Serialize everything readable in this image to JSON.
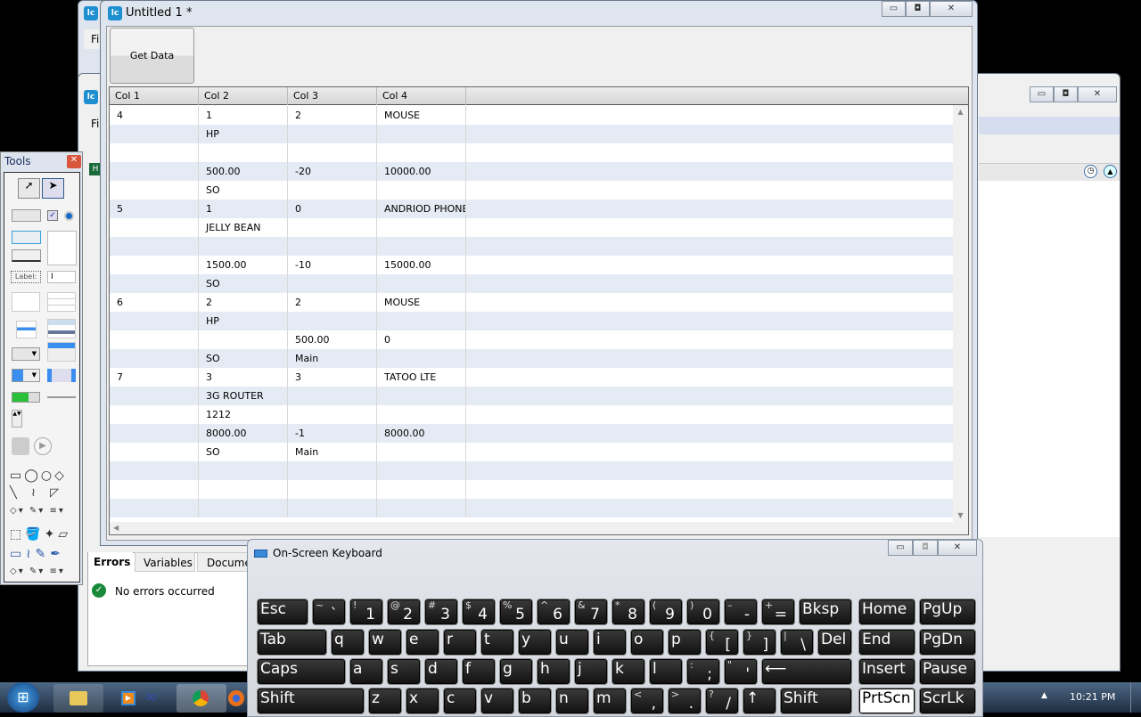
{
  "back_window": {
    "menu_initial": "Fi",
    "status_letter": "H"
  },
  "main_window": {
    "title": "Untitled 1 *",
    "get_data_label": "Get Data",
    "columns": [
      "Col 1",
      "Col 2",
      "Col 3",
      "Col 4"
    ],
    "rows": [
      [
        "4",
        "1",
        "2",
        "MOUSE"
      ],
      [
        "",
        "HP",
        "",
        ""
      ],
      [
        "",
        "",
        "",
        ""
      ],
      [
        "",
        "500.00",
        "-20",
        "10000.00"
      ],
      [
        "",
        "SO",
        "",
        ""
      ],
      [
        "5",
        "1",
        "0",
        "ANDRIOD PHONE"
      ],
      [
        "",
        "JELLY BEAN",
        "",
        ""
      ],
      [
        "",
        "",
        "",
        ""
      ],
      [
        "",
        "1500.00",
        "-10",
        "15000.00"
      ],
      [
        "",
        "SO",
        "",
        ""
      ],
      [
        "6",
        "2",
        "2",
        "MOUSE"
      ],
      [
        "",
        "HP",
        "",
        ""
      ],
      [
        "",
        "",
        "500.00",
        "0"
      ],
      [
        "",
        "SO",
        "Main",
        ""
      ],
      [
        "7",
        "3",
        "3",
        "TATOO LTE"
      ],
      [
        "",
        "3G ROUTER",
        "",
        ""
      ],
      [
        "",
        "1212",
        "",
        ""
      ],
      [
        "",
        "8000.00",
        "-1",
        "8000.00"
      ],
      [
        "",
        "SO",
        "Main",
        ""
      ],
      [
        "",
        "",
        "",
        ""
      ],
      [
        "",
        "",
        "",
        ""
      ],
      [
        "",
        "",
        "",
        ""
      ]
    ]
  },
  "tools": {
    "title": "Tools",
    "label_tool": "Label:"
  },
  "errors_panel": {
    "tabs": [
      "Errors",
      "Variables",
      "Documen"
    ],
    "message": "No errors occurred"
  },
  "keyboard": {
    "title": "On-Screen Keyboard",
    "rows": [
      [
        {
          "m": "Esc"
        },
        {
          "m": "` ",
          "s": "~"
        },
        {
          "m": "1",
          "s": "!"
        },
        {
          "m": "2",
          "s": "@"
        },
        {
          "m": "3",
          "s": "#"
        },
        {
          "m": "4",
          "s": "$"
        },
        {
          "m": "5",
          "s": "%"
        },
        {
          "m": "6",
          "s": "^"
        },
        {
          "m": "7",
          "s": "&"
        },
        {
          "m": "8",
          "s": "*"
        },
        {
          "m": "9",
          "s": "("
        },
        {
          "m": "0",
          "s": ")"
        },
        {
          "m": "-",
          "s": "–"
        },
        {
          "m": "=",
          "s": "+"
        },
        {
          "m": "Bksp"
        },
        {
          "m": "Home"
        },
        {
          "m": "PgUp"
        }
      ],
      [
        {
          "m": "Tab"
        },
        {
          "m": "q"
        },
        {
          "m": "w"
        },
        {
          "m": "e"
        },
        {
          "m": "r"
        },
        {
          "m": "t"
        },
        {
          "m": "y"
        },
        {
          "m": "u"
        },
        {
          "m": "i"
        },
        {
          "m": "o"
        },
        {
          "m": "p"
        },
        {
          "m": "[",
          "s": "{"
        },
        {
          "m": "]",
          "s": "}"
        },
        {
          "m": "\\",
          "s": "|"
        },
        {
          "m": "Del"
        },
        {
          "m": "End"
        },
        {
          "m": "PgDn"
        }
      ],
      [
        {
          "m": "Caps"
        },
        {
          "m": "a"
        },
        {
          "m": "s"
        },
        {
          "m": "d"
        },
        {
          "m": "f"
        },
        {
          "m": "g"
        },
        {
          "m": "h"
        },
        {
          "m": "j"
        },
        {
          "m": "k"
        },
        {
          "m": "l"
        },
        {
          "m": ";",
          "s": ":"
        },
        {
          "m": "'",
          "s": "\""
        },
        {
          "m": "⟵"
        },
        {
          "m": "Insert"
        },
        {
          "m": "Pause"
        }
      ],
      [
        {
          "m": "Shift"
        },
        {
          "m": "z"
        },
        {
          "m": "x"
        },
        {
          "m": "c"
        },
        {
          "m": "v"
        },
        {
          "m": "b"
        },
        {
          "m": "n"
        },
        {
          "m": "m"
        },
        {
          "m": ",",
          "s": "<"
        },
        {
          "m": ".",
          "s": ">"
        },
        {
          "m": "/",
          "s": "?"
        },
        {
          "m": "↑"
        },
        {
          "m": "Shift"
        },
        {
          "m": "PrtScn"
        },
        {
          "m": "ScrLk"
        }
      ]
    ]
  },
  "taskbar": {
    "clock": "10:21 PM"
  }
}
